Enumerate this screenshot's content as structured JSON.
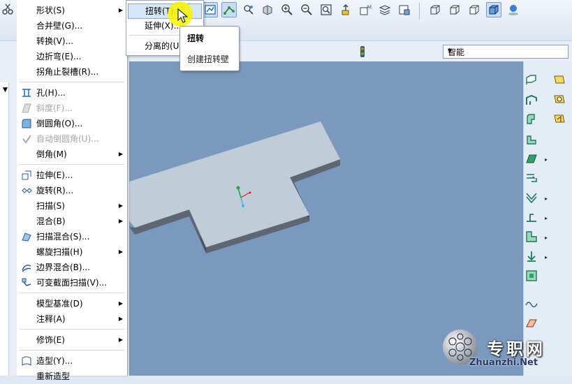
{
  "menu": {
    "items": [
      {
        "label": "形状(S)",
        "submenu": true
      },
      {
        "label": "合并壁(G)...",
        "submenu": false
      },
      {
        "label": "转换(V)...",
        "submenu": false
      },
      {
        "label": "边折弯(E)...",
        "submenu": false
      },
      {
        "label": "拐角止裂槽(R)...",
        "submenu": false
      },
      {
        "label": "孔(H)...",
        "submenu": false
      },
      {
        "label": "斜度(F)...",
        "submenu": false,
        "disabled": true
      },
      {
        "label": "倒圆角(O)...",
        "submenu": false
      },
      {
        "label": "自动倒圆角(U)...",
        "submenu": false,
        "disabled": true
      },
      {
        "label": "倒角(M)",
        "submenu": true
      },
      {
        "label": "拉伸(E)...",
        "submenu": false
      },
      {
        "label": "旋转(R)...",
        "submenu": false
      },
      {
        "label": "扫描(S)",
        "submenu": true
      },
      {
        "label": "混合(B)",
        "submenu": true
      },
      {
        "label": "扫描混合(S)...",
        "submenu": false
      },
      {
        "label": "螺旋扫描(H)",
        "submenu": true
      },
      {
        "label": "边界混合(B)...",
        "submenu": false
      },
      {
        "label": "可变截面扫描(V)...",
        "submenu": false
      },
      {
        "label": "模型基准(D)",
        "submenu": true
      },
      {
        "label": "注释(A)",
        "submenu": true
      },
      {
        "label": "修饰(E)",
        "submenu": true
      },
      {
        "label": "造型(Y)...",
        "submenu": false
      },
      {
        "label": "重新造型",
        "submenu": false
      }
    ]
  },
  "submenu": {
    "items": [
      {
        "label": "扭转(T)..."
      },
      {
        "label": "延伸(X)..."
      },
      {
        "label": "分离的(U)..."
      }
    ]
  },
  "tooltip": {
    "title": "扭转",
    "description": "创建扭转壁"
  },
  "filter": {
    "value": "智能"
  },
  "watermark": {
    "text": "专职网",
    "url": "Zhuanzhi.Net"
  },
  "colors": {
    "viewport": "#7b99be",
    "part_top": "#c0ccd8",
    "part_side": "#5d6672",
    "accent": "#2d7ad6",
    "highlight": "#f7f400"
  },
  "icons": {
    "toolbar": [
      "scissors-icon",
      "view-orient-icon",
      "datum-curve-icon",
      "saved-views-icon",
      "shading-icon",
      "zoom-in-icon",
      "zoom-out-icon",
      "refit-icon",
      "reorient-icon",
      "annotation-display-icon",
      "layers-icon",
      "model-display-icon",
      "wireframe-icon",
      "hidden-line-icon",
      "no-hidden-icon",
      "shaded-icon",
      "appearance-icon",
      "traffic-light-icon"
    ],
    "right": [
      "unbend-icon",
      "bend-back-icon",
      "flat-wall-icon",
      "flange-wall-icon",
      "extrude-wall-icon",
      "rip-icon",
      "form-icon",
      "bend-icon",
      "edge-bend-icon",
      "flatten-icon",
      "punch-icon",
      "datum-plane-icon",
      "datum-axis-icon",
      "datum-curve-icon",
      "datum-point-icon"
    ]
  }
}
